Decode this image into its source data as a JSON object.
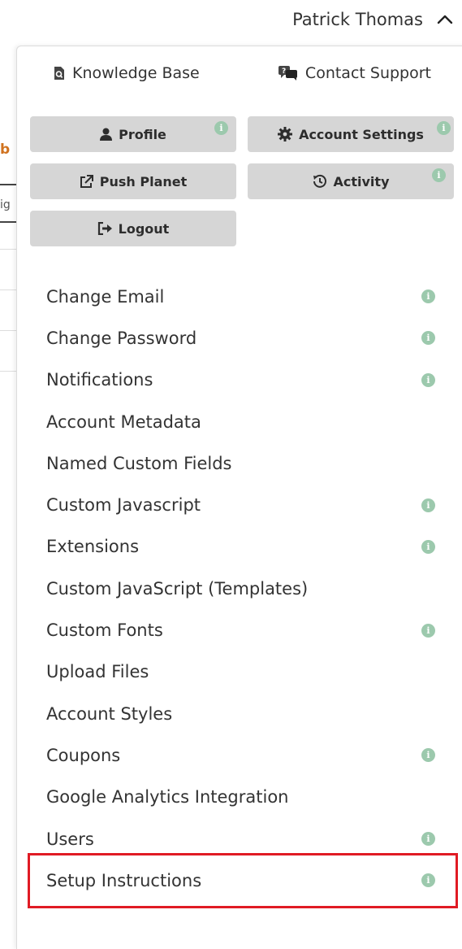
{
  "header": {
    "user_name": "Patrick Thomas"
  },
  "background": {
    "frag_b": "b",
    "frag_ig": "ig"
  },
  "top_links": {
    "knowledge_base": "Knowledge Base",
    "contact_support": "Contact Support"
  },
  "buttons": {
    "profile": "Profile",
    "account_settings": "Account Settings",
    "push_planet": "Push Planet",
    "activity": "Activity",
    "logout": "Logout"
  },
  "info_icon_glyph": "i",
  "menu_items": [
    {
      "label": "Change Email",
      "info": true
    },
    {
      "label": "Change Password",
      "info": true
    },
    {
      "label": "Notifications",
      "info": true
    },
    {
      "label": "Account Metadata",
      "info": false
    },
    {
      "label": "Named Custom Fields",
      "info": false
    },
    {
      "label": "Custom Javascript",
      "info": true
    },
    {
      "label": "Extensions",
      "info": true
    },
    {
      "label": "Custom JavaScript (Templates)",
      "info": false
    },
    {
      "label": "Custom Fonts",
      "info": true
    },
    {
      "label": "Upload Files",
      "info": false
    },
    {
      "label": "Account Styles",
      "info": false
    },
    {
      "label": "Coupons",
      "info": true
    },
    {
      "label": "Google Analytics Integration",
      "info": false
    },
    {
      "label": "Users",
      "info": true
    },
    {
      "label": "Setup Instructions",
      "info": true
    }
  ],
  "colors": {
    "info_dot": "#9cc9ad",
    "highlight": "#e01b24",
    "button_bg": "#d6d6d6"
  }
}
